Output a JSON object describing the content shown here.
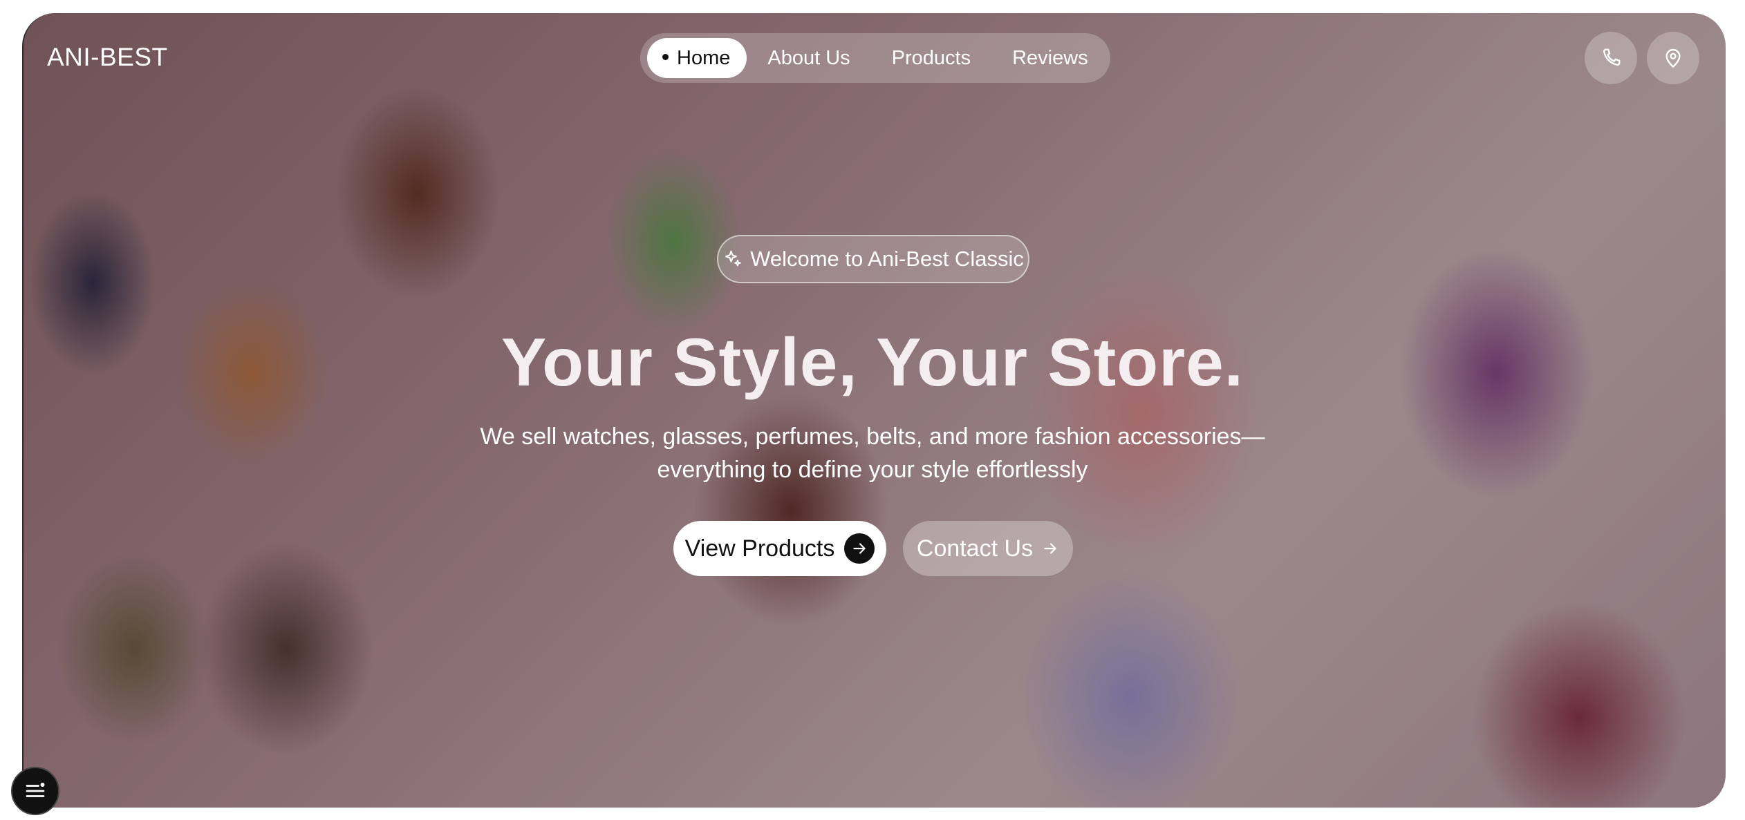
{
  "brand": {
    "logo": "ANI-BEST"
  },
  "nav": {
    "items": [
      {
        "label": "Home",
        "active": true
      },
      {
        "label": "About Us",
        "active": false
      },
      {
        "label": "Products",
        "active": false
      },
      {
        "label": "Reviews",
        "active": false
      }
    ]
  },
  "actions": {
    "phone_icon": "phone-icon",
    "location_icon": "map-pin-icon"
  },
  "hero": {
    "badge": "Welcome to Ani-Best Classic",
    "badge_icon": "sparkle-icon",
    "headline": "Your Style, Your Store.",
    "subtext_line1": "We sell watches, glasses, perfumes, belts, and more fashion accessories—",
    "subtext_line2": "everything to define your style effortlessly",
    "primary_cta": "View Products",
    "secondary_cta": "Contact Us"
  },
  "menu": {
    "icon": "menu-icon"
  },
  "colors": {
    "primary_button": "#ffffff",
    "dark": "#111111",
    "text_light": "#ffffff"
  }
}
